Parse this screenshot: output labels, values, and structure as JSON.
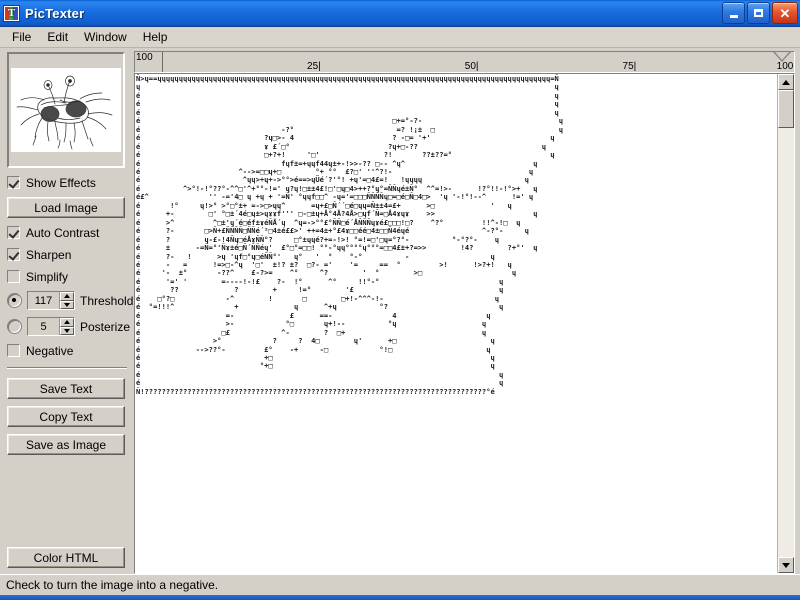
{
  "window": {
    "title": "PicTexter",
    "icon": "app-text-icon",
    "buttons": {
      "minimize": "minimize-icon",
      "maximize": "maximize-icon",
      "close": "close-icon"
    }
  },
  "menu": {
    "items": [
      {
        "label": "File"
      },
      {
        "label": "Edit"
      },
      {
        "label": "Window"
      },
      {
        "label": "Help"
      }
    ]
  },
  "sidebar": {
    "preview_alt": "flying-spaghetti-monster-line-drawing",
    "show_effects": {
      "label": "Show Effects",
      "checked": true
    },
    "load_image": {
      "label": "Load Image"
    },
    "auto_contrast": {
      "label": "Auto Contrast",
      "checked": true
    },
    "sharpen": {
      "label": "Sharpen",
      "checked": true
    },
    "simplify": {
      "label": "Simplify",
      "checked": false
    },
    "threshold": {
      "label": "Threshold",
      "value": "117",
      "selected": true
    },
    "posterize": {
      "label": "Posterize",
      "value": "5",
      "selected": false
    },
    "negative": {
      "label": "Negative",
      "checked": false
    },
    "save_text": {
      "label": "Save Text"
    },
    "copy_text": {
      "label": "Copy Text"
    },
    "save_as_image": {
      "label": "Save as Image"
    },
    "color_html": {
      "label": "Color HTML"
    }
  },
  "ruler": {
    "corner_value": "100",
    "ticks": [
      {
        "label": "25|",
        "pos_pct": 25
      },
      {
        "label": "50|",
        "pos_pct": 50
      },
      {
        "label": "75|",
        "pos_pct": 75
      },
      {
        "label": "100",
        "pos_pct": 100
      }
    ]
  },
  "editor": {
    "ascii_art": "Ñ>ɥ==ɥɥɥɥɥɥɥɥɥɥɥɥɥɥɥɥɥɥɥɥɥɥɥɥɥɥɥɥɥɥɥɥɥɥɥɥɥɥɥɥɥɥɥɥɥɥɥɥɥɥɥɥɥɥɥɥɥɥɥɥɥɥɥɥɥɥɥɥɥɥɥɥɥɥɥɥɥɥɥɥɥɥɥɥɥɥɥɥɥɥɥɥ=Ñ\nɥ                                                                                                 ɥ\né                                                                                                 ɥ\né                                                                                                 ɥ\né                                                                                                 ɥ\né                                                           □+=°-?-                                ɥ\né                                 -?°                        =? !¡±  □                             ɥ\né                             ?ɥ□>- 4                       ? -□= '+'                            ɥ\né                             ɤ £´□°                       ?ɥ+□-??                             ɥ\né                             □+?+!     '□'               ?!       ??±??=°                       ɥ\né                                 fɥf±=+ɥɥf44ɥ±+-!>>-?? □-- ^ɥ^                              ɥ\né                       ^-->=□□ɥ+□        °+ °°  £?□' ''^?!-                                ɥ\né                        ^ɥɥ>+ɥ+->°°>é==>ɥÜé´?'°! +ɥ'=□4£=!   !ɥɥɥɥ                        ɥ\né          ^>°!-!°??°-^^□'^+°°-!=' ɥ?ɥ!□±±4£!□'□ɥ□4>++?°ɥ°=ÑÑɥé±Ñ°  ^^=!>-      !?°!!-!°>+   ɥ\né£^              '' -='4□ ɥ +ɥ + '=Ñ' °ɥɥf□□^ -ɥ='=□□□ÑÑÑÑɥ□=□é□Ñ□4□>  'ɥ '-!°!--^      !=' ɥ\né       !°     ɥ!>° >°□°±+ =->□>ɥɥ^      =ɥ+£□Ñ´´□é□ɥɥ=Ñ±±4=£+      >□             '   ɥ\né      +-        □' °□±´4é□ɥ±>ɥɤɤf''' □-□±ɥ+Å°4Å?4Å>□ɥf´Ñ=□Å4ɤɥɤ    >>                       ɥ\né      >^         ^□±'ɥ´é□éf±ɤéÑÅ´ɥ  ^ɥ=->°°£°ÑÑ□é´ÅÑÑÑɥɤé£□□□!□?    ^?°         !!^-!□  ɥ\né      ?-       □>Ñ+£ÑÑÑÑ□ÑÑé´²□4±é££>' ++=4±+°£4ɤ□□éé□4±□□Ñ4éɥé                 ^-?°-     ɥ\né      ?        ɥ-£-!4Ñɥ□éÅɤÑÑ°?     □°±ɥɥé?+=-!>! °=!=□'□ɥ=°?°-          °-°?°-    ɥ\né      ±      -=Ñ=°'Ñɤ±é□Ñ´ÑÑéɥ'  £°□°=□□! °°-°ɥɥ°°°°ɥ°°°=□□4£±+?=>>        !4?        ?+°'  ɥ\né      ?-   !      >ɥ 'ɥf□°ɥ□éÑÑ°'   ɥ°   '  °    °-°          -                   ɥ\né      -   =      !=>□-^ɥ  '□'  ±!? ±?  □?- ='    '=     ==  °         >!      !>?+!   ɥ\né     '-  ±°       -??^    £-?>=    ^°     ^?        '  °        >□                     ɥ\né      '=' '        =----!-!£    ?-  !°      ^°     !!°-°                            ɥ\né       ??             ?        +     !=°        '£                                  ɥ\né    □°?□            -^        !       □        □+!-^^^-!-                          ɥ\né  °=!!!^              +             ɥ      ^+ɥ          °?                          ɥ\né                    =-             £      ==-              4                     ɥ\né                    >-            °□       ɥ+!--          °ɥ                    ɥ\né                   □£            ^-        ?  □+                                ɥ\né                 >°            ?     ?  4□        ɥ'      +□                      ɥ\né             -->??°-         £°    -+     -□            °!□                      ɥ\né                             +□                                                   ɥ\né                            °+□                                                   ɥ\né                                                                                    ɥ\né                                                                                    ɥ\nÑ!????????????????????????????????????????????????????????????????????????????????°é"
  },
  "scrollbar": {
    "up": "scroll-up-arrow-icon",
    "down": "scroll-down-arrow-icon"
  },
  "statusbar": {
    "text": "Check to turn the image into a negative."
  }
}
